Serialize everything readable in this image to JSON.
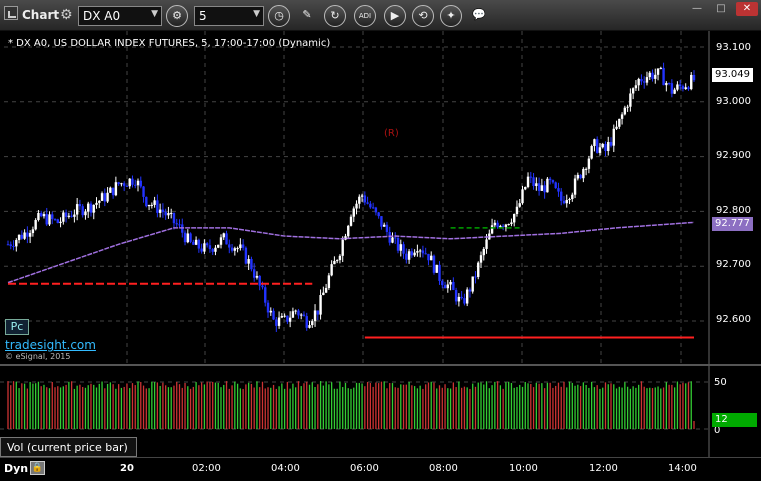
{
  "toolbar": {
    "app_title": "Chart",
    "symbol": "DX A0",
    "interval": "5",
    "icons": [
      "cog-icon",
      "clock-icon",
      "pencil-icon",
      "cursor-icon",
      "study-icon",
      "play-icon",
      "replay-icon",
      "draw-icon",
      "chat-icon"
    ],
    "study_label": "ADI"
  },
  "chart": {
    "header": "* DX A0, US DOLLAR INDEX FUTURES, 5, 17:00-17:00 (Dynamic)",
    "pc_badge": "Pc",
    "link": "tradesight.com",
    "copyright": "© eSignal, 2015",
    "annotation": "(R)",
    "price_axis": [
      "93.100",
      "93.000",
      "92.900",
      "92.800",
      "92.700",
      "92.600"
    ],
    "last_price": "93.049",
    "ma_price": "92.777",
    "colors": {
      "up": "#ffffff",
      "down": "#2233ff",
      "ma": "#a070e0",
      "support": "#ff2020",
      "target": "#00a000",
      "count": "#33aa33",
      "grid": "#444444",
      "annotation": "#aa1111"
    }
  },
  "chart_data": {
    "type": "bar",
    "title": "* DX A0, US DOLLAR INDEX FUTURES, 5, 17:00-17:00 (Dynamic)",
    "ylim": [
      92.55,
      93.12
    ],
    "x_ticks": [
      "20",
      "02:00",
      "04:00",
      "06:00",
      "08:00",
      "10:00",
      "12:00",
      "14:00"
    ],
    "close_path": [
      [
        0,
        92.74
      ],
      [
        6,
        92.76
      ],
      [
        12,
        92.79
      ],
      [
        18,
        92.78
      ],
      [
        24,
        92.8
      ],
      [
        30,
        92.81
      ],
      [
        36,
        92.83
      ],
      [
        40,
        92.85
      ],
      [
        46,
        92.86
      ],
      [
        50,
        92.82
      ],
      [
        56,
        92.8
      ],
      [
        62,
        92.77
      ],
      [
        66,
        92.74
      ],
      [
        72,
        92.73
      ],
      [
        78,
        92.75
      ],
      [
        84,
        92.73
      ],
      [
        88,
        92.7
      ],
      [
        92,
        92.65
      ],
      [
        96,
        92.6
      ],
      [
        100,
        92.6
      ],
      [
        104,
        92.62
      ],
      [
        108,
        92.6
      ],
      [
        112,
        92.62
      ],
      [
        116,
        92.68
      ],
      [
        120,
        92.73
      ],
      [
        124,
        92.8
      ],
      [
        128,
        92.83
      ],
      [
        132,
        92.8
      ],
      [
        136,
        92.77
      ],
      [
        140,
        92.74
      ],
      [
        144,
        92.72
      ],
      [
        148,
        92.74
      ],
      [
        152,
        92.72
      ],
      [
        156,
        92.68
      ],
      [
        160,
        92.66
      ],
      [
        164,
        92.63
      ],
      [
        168,
        92.67
      ],
      [
        172,
        92.73
      ],
      [
        176,
        92.78
      ],
      [
        180,
        92.78
      ],
      [
        184,
        92.8
      ],
      [
        188,
        92.86
      ],
      [
        192,
        92.84
      ],
      [
        196,
        92.85
      ],
      [
        200,
        92.82
      ],
      [
        204,
        92.84
      ],
      [
        208,
        92.88
      ],
      [
        212,
        92.92
      ],
      [
        216,
        92.91
      ],
      [
        220,
        92.95
      ],
      [
        224,
        93.0
      ],
      [
        228,
        93.04
      ],
      [
        232,
        93.05
      ],
      [
        236,
        93.05
      ],
      [
        240,
        93.02
      ],
      [
        244,
        93.03
      ],
      [
        248,
        93.04
      ]
    ],
    "moving_average": [
      [
        0,
        92.67
      ],
      [
        40,
        92.74
      ],
      [
        60,
        92.77
      ],
      [
        80,
        92.77
      ],
      [
        100,
        92.755
      ],
      [
        120,
        92.75
      ],
      [
        140,
        92.755
      ],
      [
        160,
        92.75
      ],
      [
        180,
        92.755
      ],
      [
        200,
        92.76
      ],
      [
        220,
        92.77
      ],
      [
        248,
        92.78
      ]
    ],
    "levels": [
      {
        "name": "support",
        "value": 92.668,
        "from": 0,
        "to": 110
      },
      {
        "name": "support-2",
        "value": 92.57,
        "from": 129,
        "to": 248
      },
      {
        "name": "target",
        "value": 92.77,
        "from": 160,
        "to": 185
      }
    ],
    "volume_axis": [
      "50",
      "0"
    ],
    "volume_value": "12"
  },
  "volume": {
    "label": "Vol (current price bar)",
    "axis": [
      "50",
      "0"
    ],
    "value": "12"
  },
  "bottom": {
    "mode": "Dyn",
    "icon": "lock-icon",
    "times": [
      "20",
      "02:00",
      "04:00",
      "06:00",
      "08:00",
      "10:00",
      "12:00",
      "14:00"
    ]
  },
  "window": {
    "buttons": [
      "minimize",
      "maximize",
      "close"
    ]
  }
}
